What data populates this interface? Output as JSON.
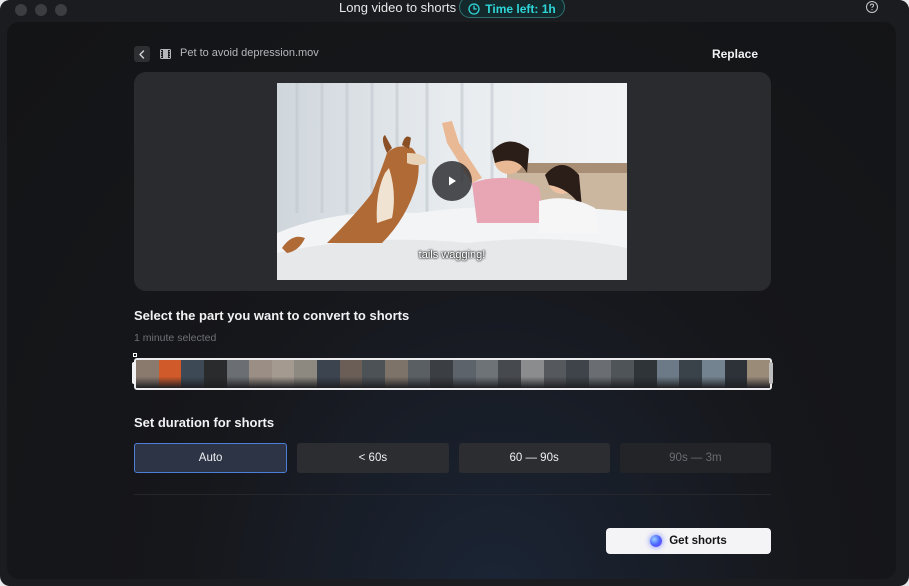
{
  "titlebar": {
    "title": "Long video to shorts",
    "time_left": "Time left: 1h"
  },
  "file": {
    "name": "Pet to avoid depression.mov",
    "replace_label": "Replace"
  },
  "preview": {
    "caption": "tails wagging!"
  },
  "selection": {
    "title": "Select the part you want to convert to shorts",
    "subtitle": "1 minute selected"
  },
  "duration": {
    "title": "Set duration for shorts",
    "options": [
      {
        "label": "Auto",
        "state": "selected"
      },
      {
        "label": "< 60s",
        "state": "normal"
      },
      {
        "label": "60 — 90s",
        "state": "normal"
      },
      {
        "label": "90s — 3m",
        "state": "disabled"
      }
    ]
  },
  "action": {
    "get_shorts_label": "Get shorts"
  },
  "colors": {
    "accent": "#2fd6d8",
    "selected_border": "#4e7fd8",
    "background": "#16171b"
  },
  "timeline_thumbs": [
    "#8a7a6e",
    "#d05a2a",
    "#3d4a55",
    "#2a2b2d",
    "#6b6f73",
    "#9a8e85",
    "#a59a90",
    "#8d8880",
    "#3c4450",
    "#6a5e57",
    "#4d5257",
    "#7e7369",
    "#5a5f63",
    "#3b3e42",
    "#5c636a",
    "#6e7378",
    "#46494d",
    "#8a8c8e",
    "#55585c",
    "#3e4449",
    "#6a6e72",
    "#4f5458",
    "#2f3439",
    "#6b7a86",
    "#3a424a",
    "#748390",
    "#2c3238",
    "#9a8b79"
  ]
}
